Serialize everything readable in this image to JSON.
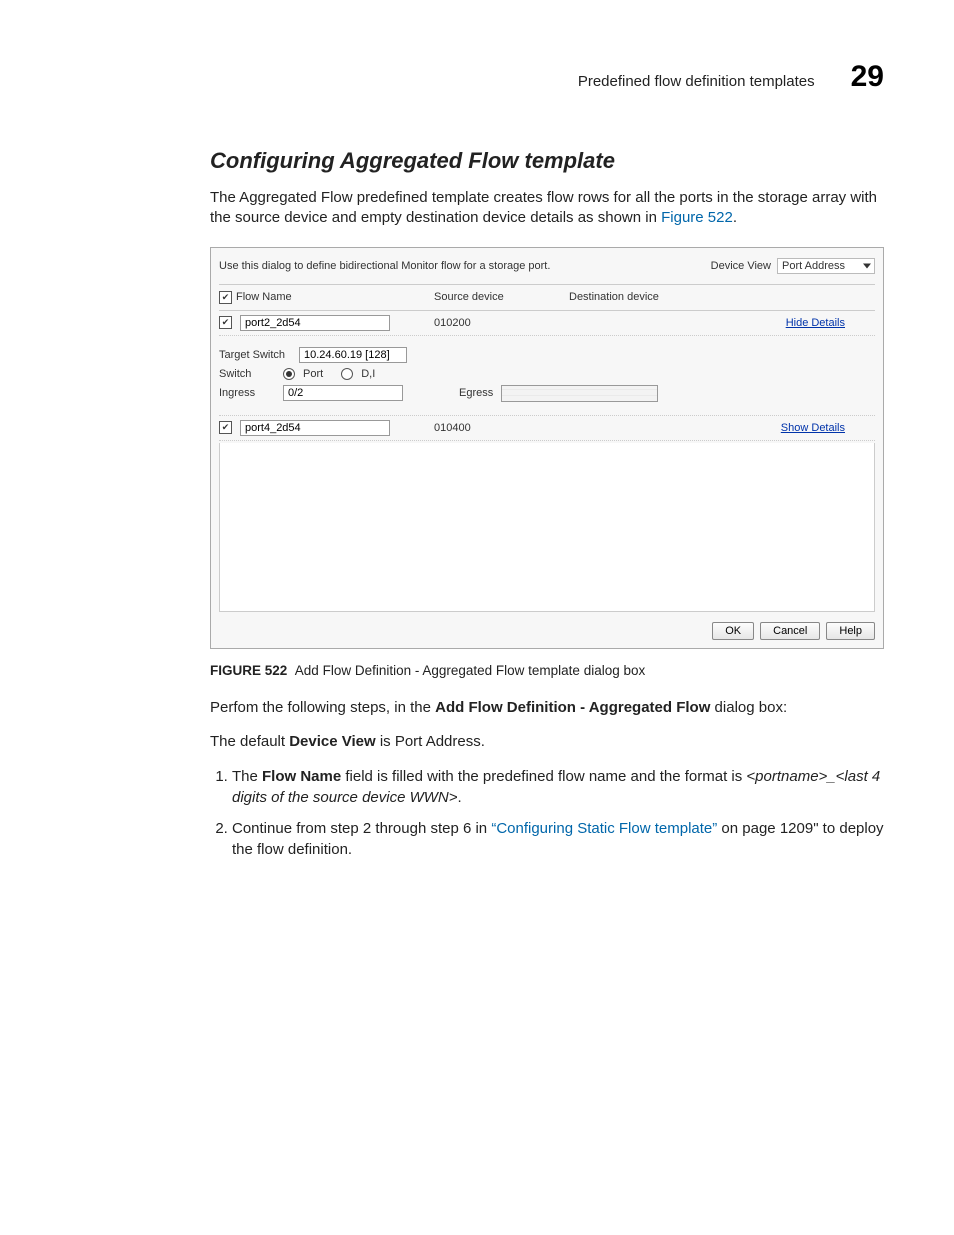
{
  "header": {
    "running_title": "Predefined flow definition templates",
    "page_number": "29"
  },
  "section": {
    "title": "Configuring Aggregated Flow template",
    "intro_a": "The Aggregated Flow predefined template creates flow rows for all the ports in the storage array with the source device and empty destination device details as shown in ",
    "intro_link": "Figure 522",
    "intro_b": "."
  },
  "dialog": {
    "instruction": "Use this dialog to define bidirectional Monitor flow for a storage port.",
    "device_view_label": "Device View",
    "device_view_value": "Port Address",
    "headers": {
      "flow_name": "Flow Name",
      "source": "Source device",
      "destination": "Destination device"
    },
    "row1": {
      "flow_name": "port2_2d54",
      "source": "010200",
      "link": "Hide Details"
    },
    "details": {
      "target_switch_label": "Target Switch",
      "target_switch_value": "10.24.60.19 [128]",
      "switch_label": "Switch",
      "radio_port": "Port",
      "radio_dj": "D,I",
      "ingress_label": "Ingress",
      "ingress_value": "0/2",
      "egress_label": "Egress"
    },
    "row2": {
      "flow_name": "port4_2d54",
      "source": "010400",
      "link": "Show Details"
    },
    "buttons": {
      "ok": "OK",
      "cancel": "Cancel",
      "help": "Help"
    }
  },
  "figure_caption": {
    "label": "FIGURE 522",
    "text": "Add Flow Definition - Aggregated Flow template dialog box"
  },
  "after": {
    "perform_a": "Perfom the following steps, in the ",
    "perform_b": "Add Flow Definition - Aggregated Flow",
    "perform_c": " dialog box:",
    "default_a": "The default ",
    "default_b": "Device View",
    "default_c": " is Port Address."
  },
  "steps": {
    "s1_a": "The ",
    "s1_b": "Flow Name",
    "s1_c": " field is filled with the predefined flow name and the format is ",
    "s1_d": "<portname>_<last 4 digits of the source device WWN>",
    "s1_e": ".",
    "s2_a": "Continue from step 2 through step 6 in ",
    "s2_link": "“Configuring Static Flow template”",
    "s2_b": " on page 1209\" to deploy the flow definition."
  }
}
